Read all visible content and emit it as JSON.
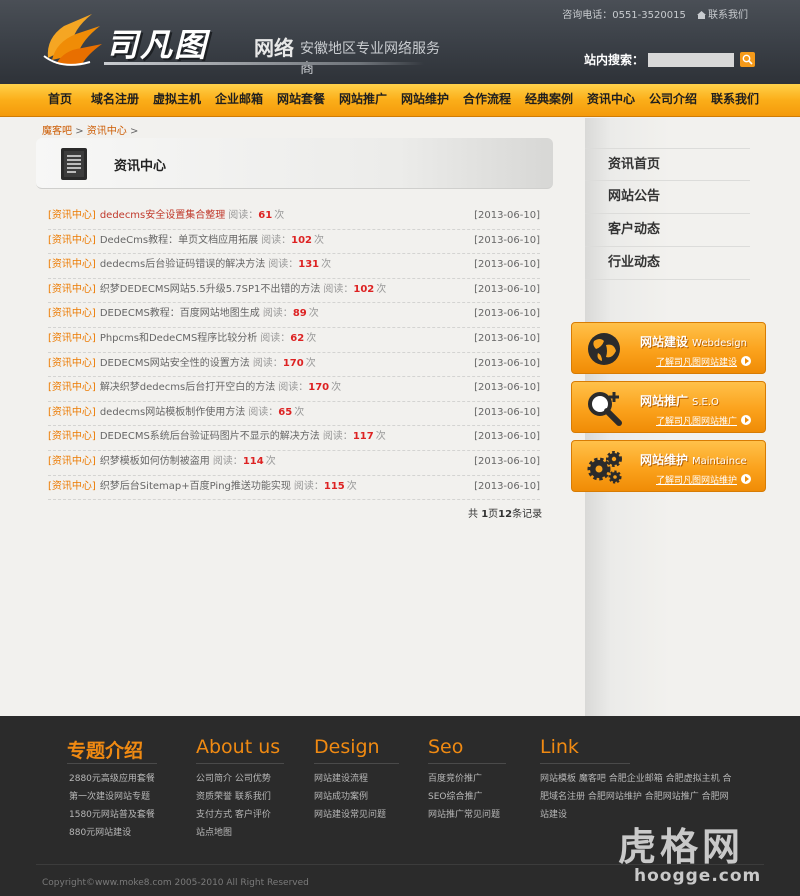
{
  "header": {
    "logo_text": "司凡图",
    "logo_suffix": "网络",
    "slogan": "安徽地区专业网络服务商",
    "phone": "咨询电话：0551-3520015",
    "contact_link": "联系我们",
    "search_label": "站内搜索："
  },
  "nav": [
    "首页",
    "域名注册",
    "虚拟主机",
    "企业邮箱",
    "网站套餐",
    "网站推广",
    "网站维护",
    "合作流程",
    "经典案例",
    "资讯中心",
    "公司介绍",
    "联系我们"
  ],
  "breadcrumb": {
    "home": "魔客吧",
    "sep": ">",
    "current": "资讯中心",
    "tail": ">"
  },
  "section_title": "资讯中心",
  "articles": [
    {
      "cat": "[资讯中心]",
      "title": "dedecms安全设置集合整理",
      "read": "阅读：",
      "count": "61",
      "unit": "次",
      "date": "[2013-06-10]"
    },
    {
      "cat": "[资讯中心]",
      "title": "DedeCms教程：单页文档应用拓展",
      "read": "阅读：",
      "count": "102",
      "unit": "次",
      "date": "[2013-06-10]"
    },
    {
      "cat": "[资讯中心]",
      "title": "dedecms后台验证码错误的解决方法",
      "read": "阅读：",
      "count": "131",
      "unit": "次",
      "date": "[2013-06-10]"
    },
    {
      "cat": "[资讯中心]",
      "title": "织梦DEDECMS网站5.5升级5.7SP1不出错的方法",
      "read": "阅读：",
      "count": "102",
      "unit": "次",
      "date": "[2013-06-10]"
    },
    {
      "cat": "[资讯中心]",
      "title": "DEDECMS教程：百度网站地图生成",
      "read": "阅读：",
      "count": "89",
      "unit": "次",
      "date": "[2013-06-10]"
    },
    {
      "cat": "[资讯中心]",
      "title": "Phpcms和DedeCMS程序比较分析",
      "read": "阅读：",
      "count": "62",
      "unit": "次",
      "date": "[2013-06-10]"
    },
    {
      "cat": "[资讯中心]",
      "title": "DEDECMS网站安全性的设置方法",
      "read": "阅读：",
      "count": "170",
      "unit": "次",
      "date": "[2013-06-10]"
    },
    {
      "cat": "[资讯中心]",
      "title": "解决织梦dedecms后台打开空白的方法",
      "read": "阅读：",
      "count": "170",
      "unit": "次",
      "date": "[2013-06-10]"
    },
    {
      "cat": "[资讯中心]",
      "title": "dedecms网站模板制作使用方法",
      "read": "阅读：",
      "count": "65",
      "unit": "次",
      "date": "[2013-06-10]"
    },
    {
      "cat": "[资讯中心]",
      "title": "DEDECMS系统后台验证码图片不显示的解决方法",
      "read": "阅读：",
      "count": "117",
      "unit": "次",
      "date": "[2013-06-10]"
    },
    {
      "cat": "[资讯中心]",
      "title": "织梦模板如何仿制被盗用",
      "read": "阅读：",
      "count": "114",
      "unit": "次",
      "date": "[2013-06-10]"
    },
    {
      "cat": "[资讯中心]",
      "title": "织梦后台Sitemap+百度Ping推送功能实现",
      "read": "阅读：",
      "count": "115",
      "unit": "次",
      "date": "[2013-06-10]"
    }
  ],
  "pager": {
    "prefix": "共 ",
    "pages": "1",
    "mid": "页",
    "records": "12",
    "suffix": "条记录"
  },
  "side_menu": [
    "资讯首页",
    "网站公告",
    "客户动态",
    "行业动态"
  ],
  "promos": [
    {
      "title": "网站建设",
      "sub": "Webdesign",
      "link": "了解司凡图网站建设",
      "icon": "globe-icon"
    },
    {
      "title": "网站推广",
      "sub": "S.E.O",
      "link": "了解司凡图网站推广",
      "icon": "magnifier-plus-icon"
    },
    {
      "title": "网站维护",
      "sub": "Maintaince",
      "link": "了解司凡图网站维护",
      "icon": "gears-icon"
    }
  ],
  "footer": {
    "col1": {
      "title": "专题介绍",
      "items": [
        "2880元高级应用套餐",
        "第一次建设网站专题",
        "1580元网站普及套餐",
        "880元网站建设"
      ]
    },
    "col2": {
      "title": "About us",
      "items": [
        "公司简介 公司优势",
        "资质荣誉 联系我们",
        "支付方式 客户评价",
        "站点地图"
      ]
    },
    "col3": {
      "title": "Design",
      "items": [
        "网站建设流程",
        "网站成功案例",
        "网站建设常见问题"
      ]
    },
    "col4": {
      "title": "Seo",
      "items": [
        "百度竞价推广",
        "SEO综合推广",
        "网站推广常见问题"
      ]
    },
    "col5": {
      "title": "Link",
      "items": [
        "网站模板 魔客吧 合肥企业邮箱 合肥虚拟主机 合",
        "肥域名注册 合肥网站维护 合肥网站推广 合肥网",
        "站建设"
      ]
    },
    "copyright": "Copyright©www.moke8.com 2005-2010 All Right Reserved"
  },
  "watermark": {
    "main": "虎格网",
    "sub": "hoogge.com"
  },
  "colors": {
    "accent": "#f59a1a",
    "header_bg": "#3a3f46",
    "footer_bg": "#2b2b2b",
    "link": "#ec7a00",
    "count": "#dd2222"
  }
}
